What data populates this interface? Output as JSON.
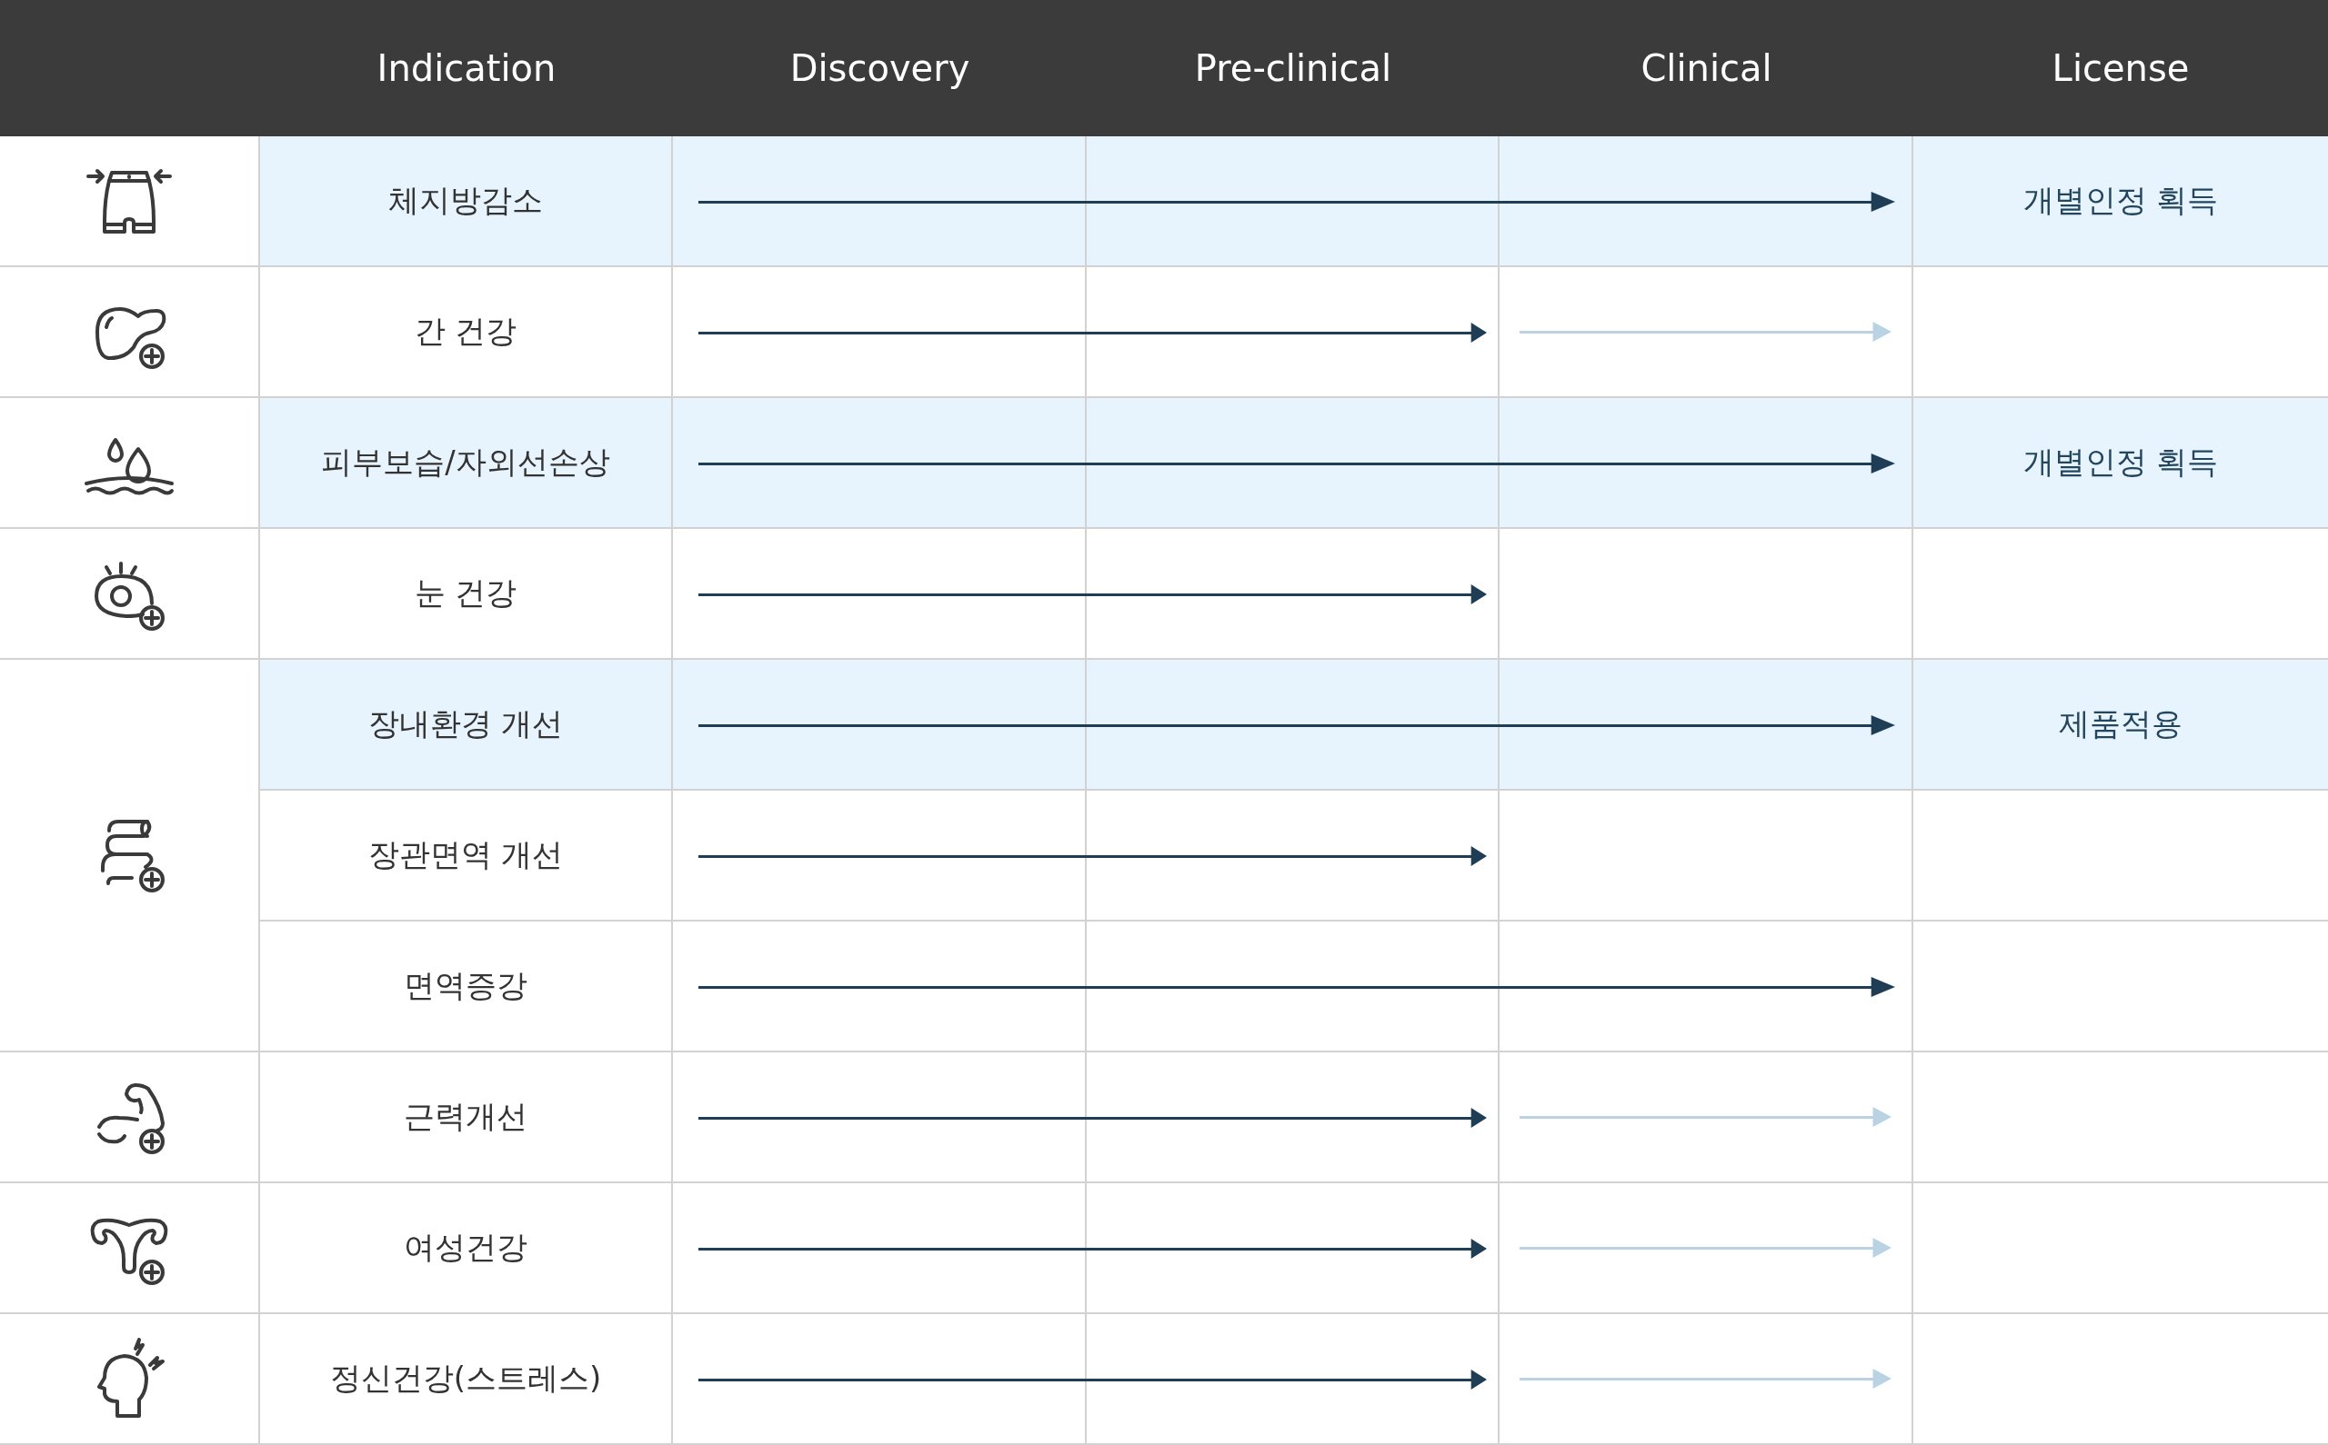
{
  "columns": [
    "Indication",
    "Discovery",
    "Pre-clinical",
    "Clinical",
    "License"
  ],
  "groups": [
    {
      "kind": "waist",
      "rows": [
        {
          "indication": "체지방감소",
          "highlighted": true,
          "clinical_done": true,
          "planned": false,
          "license": "개별인정 획득"
        }
      ]
    },
    {
      "kind": "liver",
      "rows": [
        {
          "indication": "간 건강",
          "highlighted": false,
          "clinical_done": false,
          "planned": true
        }
      ]
    },
    {
      "kind": "skin",
      "rows": [
        {
          "indication": "피부보습/자외선손상",
          "highlighted": true,
          "clinical_done": true,
          "planned": false,
          "license": "개별인정 획득"
        }
      ]
    },
    {
      "kind": "eye",
      "rows": [
        {
          "indication": "눈 건강",
          "highlighted": false,
          "clinical_done": false,
          "planned": false
        }
      ]
    },
    {
      "kind": "gut",
      "rows": [
        {
          "indication": "장내환경 개선",
          "highlighted": true,
          "clinical_done": true,
          "planned": false,
          "license": "제품적용"
        },
        {
          "indication": "장관면역 개선",
          "highlighted": false,
          "clinical_done": false,
          "planned": false
        },
        {
          "indication": "면역증강",
          "highlighted": false,
          "clinical_done": true,
          "planned": false
        }
      ]
    },
    {
      "kind": "muscle",
      "rows": [
        {
          "indication": "근력개선",
          "highlighted": false,
          "clinical_done": false,
          "planned": true
        }
      ]
    },
    {
      "kind": "uterus",
      "rows": [
        {
          "indication": "여성건강",
          "highlighted": false,
          "clinical_done": false,
          "planned": true
        }
      ]
    },
    {
      "kind": "head",
      "rows": [
        {
          "indication": "정신건강(스트레스)",
          "highlighted": false,
          "clinical_done": false,
          "planned": true
        }
      ]
    }
  ]
}
